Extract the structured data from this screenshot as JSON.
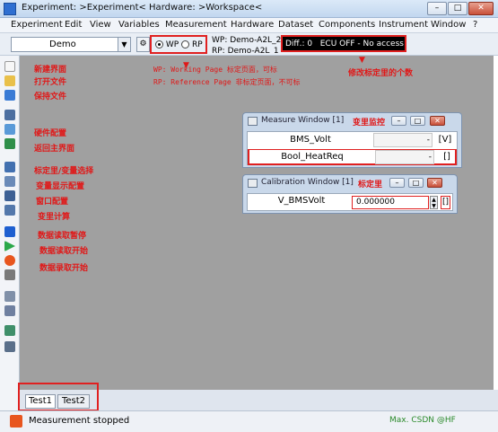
{
  "titlebar": {
    "title": "Experiment: >Experiment< Hardware: >Workspace<",
    "min": "–",
    "max": "□",
    "close": "✕"
  },
  "menu": [
    "Experiment",
    "Edit",
    "View",
    "Variables",
    "Measurement",
    "Hardware",
    "Dataset",
    "Components",
    "Instrument",
    "Window",
    "?"
  ],
  "toolbar": {
    "combo_value": "Demo",
    "wp_label": "WP",
    "rp_label": "RP",
    "wp_page": "WP: Demo-A2L_2",
    "rp_page": "RP: Demo-A2L_1",
    "diff_label": "Diff.: 0",
    "ecu_status": "ECU OFF - No access"
  },
  "annotations": {
    "wp_note": "WP: Working Page  标定页面，可标",
    "rp_note": "RP: Reference Page  非标定页面，不可标",
    "diff_note": "修改标定里的个数",
    "left": [
      "新建界面",
      "打开文件",
      "保持文件",
      "硬件配置",
      "返回主界面",
      "标定里/变量选择",
      "变量显示配置",
      "窗口配置",
      "变里计算",
      "数据读取暂停",
      "数据读取开始",
      "数据录取开始"
    ],
    "measure_note": "变里监控",
    "calib_note": "标定里"
  },
  "measure_window": {
    "title": "Measure Window [1]",
    "rows": [
      {
        "name": "BMS_Volt",
        "value": "-",
        "unit": "[V]"
      },
      {
        "name": "Bool_HeatReq",
        "value": "-",
        "unit": "[]"
      }
    ]
  },
  "calibration_window": {
    "title": "Calibration Window [1]",
    "name": "V_BMSVolt",
    "value": "0.000000",
    "unit": "[]"
  },
  "tabs": [
    "Test1",
    "Test2"
  ],
  "status": {
    "text": "Measurement stopped",
    "right": "Max. CSDN @HF"
  },
  "colors": {
    "accent_red": "#e02020",
    "workspace_gray": "#a0a0a0",
    "titlebar_blue": "#c2d7ef"
  }
}
